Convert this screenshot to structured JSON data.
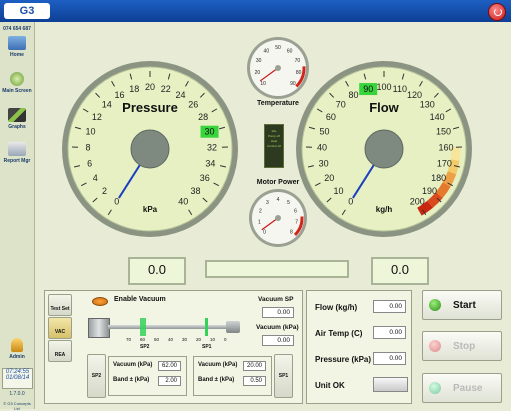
{
  "app": {
    "logo_text": "G3"
  },
  "sidebar": {
    "phone": "074 654 687",
    "items": [
      {
        "label": "Home",
        "icon": "home-icon"
      },
      {
        "label": "Main Screen",
        "icon": "main-screen-icon"
      },
      {
        "label": "Graphs",
        "icon": "graphs-icon"
      },
      {
        "label": "Report Mgr",
        "icon": "report-icon"
      },
      {
        "label": "Admin",
        "icon": "admin-key-icon"
      }
    ],
    "time": "07:24:55",
    "date": "01/08/14",
    "version": "1.7.0.0",
    "copyright": "© G3 Concepts Ltd"
  },
  "gauges": {
    "pressure": {
      "title": "Pressure",
      "unit": "kPa",
      "value": 0,
      "max": 40,
      "ticks": [
        "0",
        "2",
        "4",
        "6",
        "8",
        "10",
        "12",
        "14",
        "16",
        "18",
        "20",
        "22",
        "24",
        "26",
        "28",
        "30",
        "32",
        "34",
        "36",
        "38",
        "40"
      ],
      "setpoint": "30"
    },
    "flow": {
      "title": "Flow",
      "unit": "kg/h",
      "value": 0,
      "max": 200,
      "ticks": [
        "0",
        "10",
        "20",
        "30",
        "40",
        "50",
        "60",
        "70",
        "80",
        "90",
        "100",
        "110",
        "120",
        "130",
        "140",
        "150",
        "160",
        "170",
        "180",
        "190",
        "200"
      ],
      "setpoint": "90"
    },
    "temperature": {
      "title": "Temperature",
      "ticks": [
        "10",
        "20",
        "30",
        "40",
        "50",
        "60",
        "70",
        "80",
        "90"
      ]
    },
    "motor_power": {
      "title": "Motor Power",
      "ticks": [
        "0",
        "1",
        "2",
        "3",
        "4",
        "5",
        "6",
        "7",
        "8"
      ]
    },
    "middle_status": {
      "lines": [
        "Idle",
        "Pump off",
        "Heat",
        "Control off"
      ]
    }
  },
  "readouts": {
    "pressure": "0.0",
    "flow": "0.0",
    "middle": ""
  },
  "vacuum": {
    "tabs": [
      "Test Set",
      "VAC",
      "REA"
    ],
    "enable_label": "Enable Vacuum",
    "scale": [
      "70",
      "60",
      "50",
      "40",
      "30",
      "20",
      "10",
      "0"
    ],
    "sp2_marker": "SP2",
    "sp1_marker": "SP1",
    "sp_label": "Vacuum SP",
    "sp_value": "0.00",
    "vac_label": "Vacuum (kPa)",
    "vac_value": "0.00",
    "sp2": {
      "button": "SP2",
      "vac_label": "Vacuum (kPa)",
      "vac_value": "62.00",
      "band_label": "Band ± (kPa)",
      "band_value": "2.00"
    },
    "sp1": {
      "button": "SP1",
      "vac_label": "Vacuum (kPa)",
      "vac_value": "20.00",
      "band_label": "Band ± (kPa)",
      "band_value": "0.50"
    }
  },
  "measurements": {
    "flow_label": "Flow (kg/h)",
    "flow_value": "0.00",
    "air_label": "Air Temp (C)",
    "air_value": "0.00",
    "pressure_label": "Pressure (kPa)",
    "pressure_value": "0.00",
    "unit_ok_label": "Unit OK"
  },
  "controls": {
    "start": "Start",
    "stop": "Stop",
    "pause": "Pause"
  },
  "colors": {
    "title_bar": "#1d5fc2",
    "gauge_face": "#e6f0c2",
    "gauge_rim": "#8b9482",
    "needle": "#1b3fbf",
    "start_led": "#3fae2a",
    "stop_led": "#e59a9a",
    "pause_led": "#8fd3b0"
  }
}
